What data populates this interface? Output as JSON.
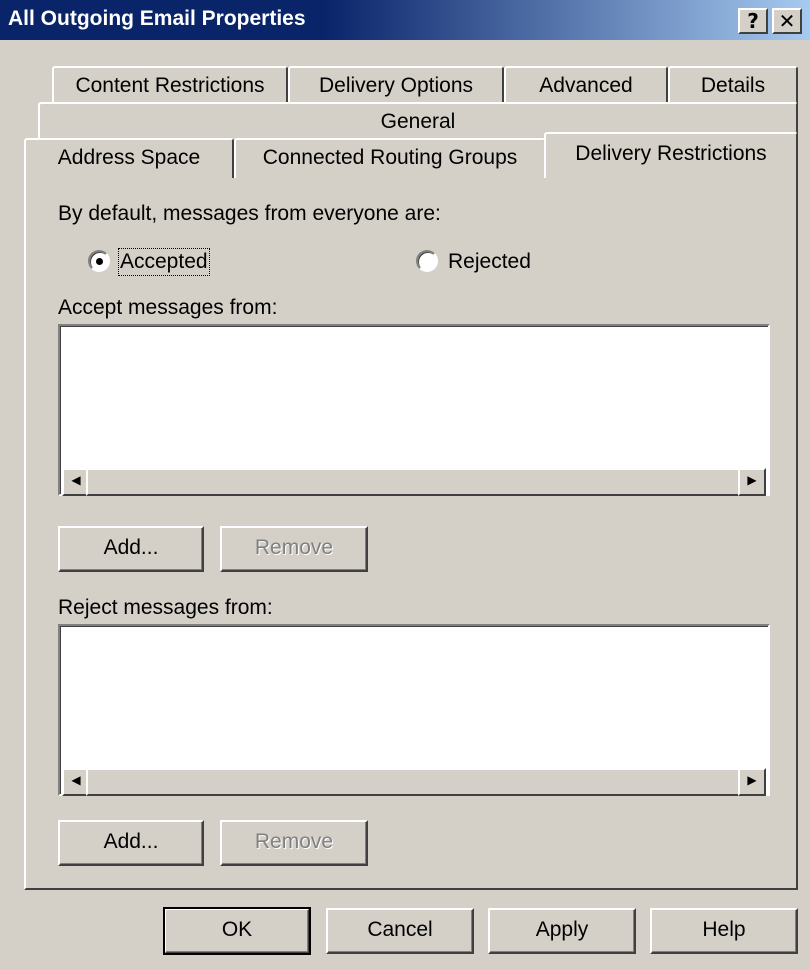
{
  "window": {
    "title": "All Outgoing Email Properties",
    "help_button": "?",
    "close_button": "✕"
  },
  "tabs": {
    "row1": [
      "Content Restrictions",
      "Delivery Options",
      "Advanced",
      "Details"
    ],
    "row2": [
      "General"
    ],
    "row3": [
      "Address Space",
      "Connected Routing Groups",
      "Delivery Restrictions"
    ],
    "active": "Delivery Restrictions"
  },
  "default_section": {
    "label": "By default, messages from everyone are:",
    "options": [
      "Accepted",
      "Rejected"
    ],
    "selected": "Accepted"
  },
  "accept_section": {
    "label": "Accept messages from:",
    "items": [],
    "add_label": "Add...",
    "remove_label": "Remove"
  },
  "reject_section": {
    "label": "Reject messages from:",
    "items": [],
    "add_label": "Add...",
    "remove_label": "Remove"
  },
  "footer": {
    "ok": "OK",
    "cancel": "Cancel",
    "apply": "Apply",
    "help": "Help"
  },
  "icons": {
    "scroll_left": "left-arrow-icon",
    "scroll_right": "right-arrow-icon"
  }
}
